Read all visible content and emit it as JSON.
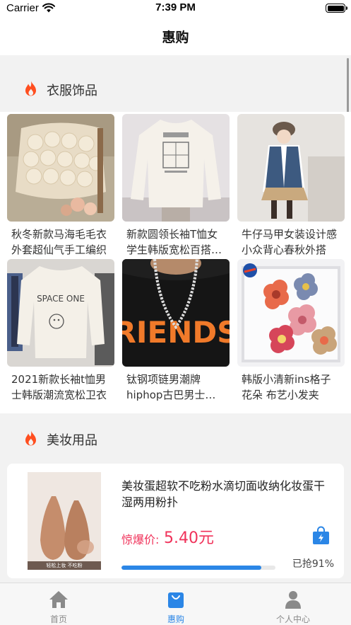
{
  "status_bar": {
    "carrier": "Carrier",
    "time": "7:39 PM"
  },
  "nav": {
    "title": "惠购"
  },
  "sections": [
    {
      "title": "衣服饰品",
      "icon": "flame-icon"
    },
    {
      "title": "美妆用品",
      "icon": "flame-icon"
    }
  ],
  "products": [
    {
      "name": "秋冬新款马海毛毛衣外套超仙气手工编织"
    },
    {
      "name": "新款圆领长袖T恤女学生韩版宽松百搭上衣"
    },
    {
      "name": "牛仔马甲女装设计感小众背心春秋外搭"
    },
    {
      "name": "2021新款长袖t恤男士韩版潮流宽松卫衣"
    },
    {
      "name": "钛钢项链男潮牌hiphop古巴男士链条"
    },
    {
      "name": "韩版小清新ins格子花朵 布艺小发夹"
    }
  ],
  "deal": {
    "name": "美妆蛋超软不吃粉水滴切面收纳化妆蛋干湿两用粉扑",
    "price_label": "惊爆价:",
    "price": "5.40元",
    "progress": 0.91,
    "grab_text": "已抢91%",
    "image_caption": "轻松上妆 不吃粉"
  },
  "tabs": [
    {
      "label": "首页",
      "icon": "home-icon",
      "active": false
    },
    {
      "label": "惠购",
      "icon": "shopping-bag-icon",
      "active": true
    },
    {
      "label": "个人中心",
      "icon": "user-icon",
      "active": false
    }
  ],
  "colors": {
    "accent": "#2b86e6",
    "price": "#f0325a",
    "flame": "#ff4e1f"
  }
}
